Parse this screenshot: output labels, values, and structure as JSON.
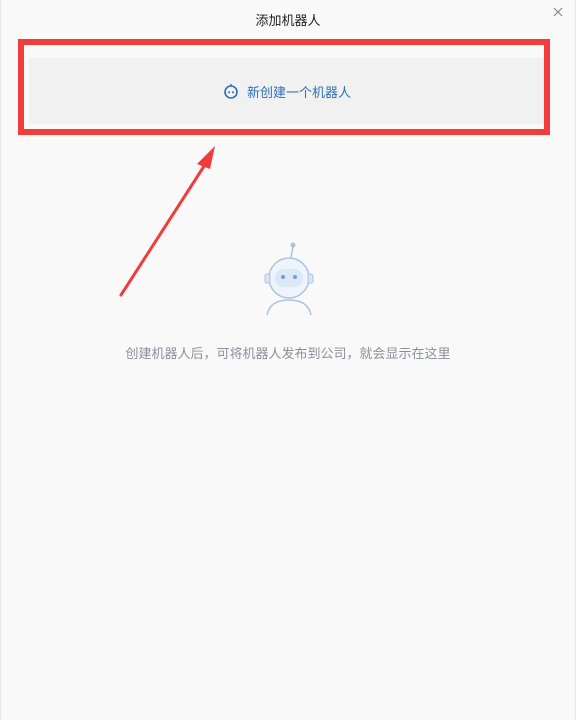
{
  "dialog": {
    "title": "添加机器人",
    "create_button_label": "新创建一个机器人",
    "empty_message": "创建机器人后，可将机器人发布到公司，就会显示在这里"
  },
  "icons": {
    "close": "close-icon",
    "robot_small": "robot-icon",
    "robot_large": "robot-illustration"
  },
  "colors": {
    "accent": "#2f6fb6",
    "highlight": "#f23b3b",
    "muted_text": "#8a8f99"
  }
}
